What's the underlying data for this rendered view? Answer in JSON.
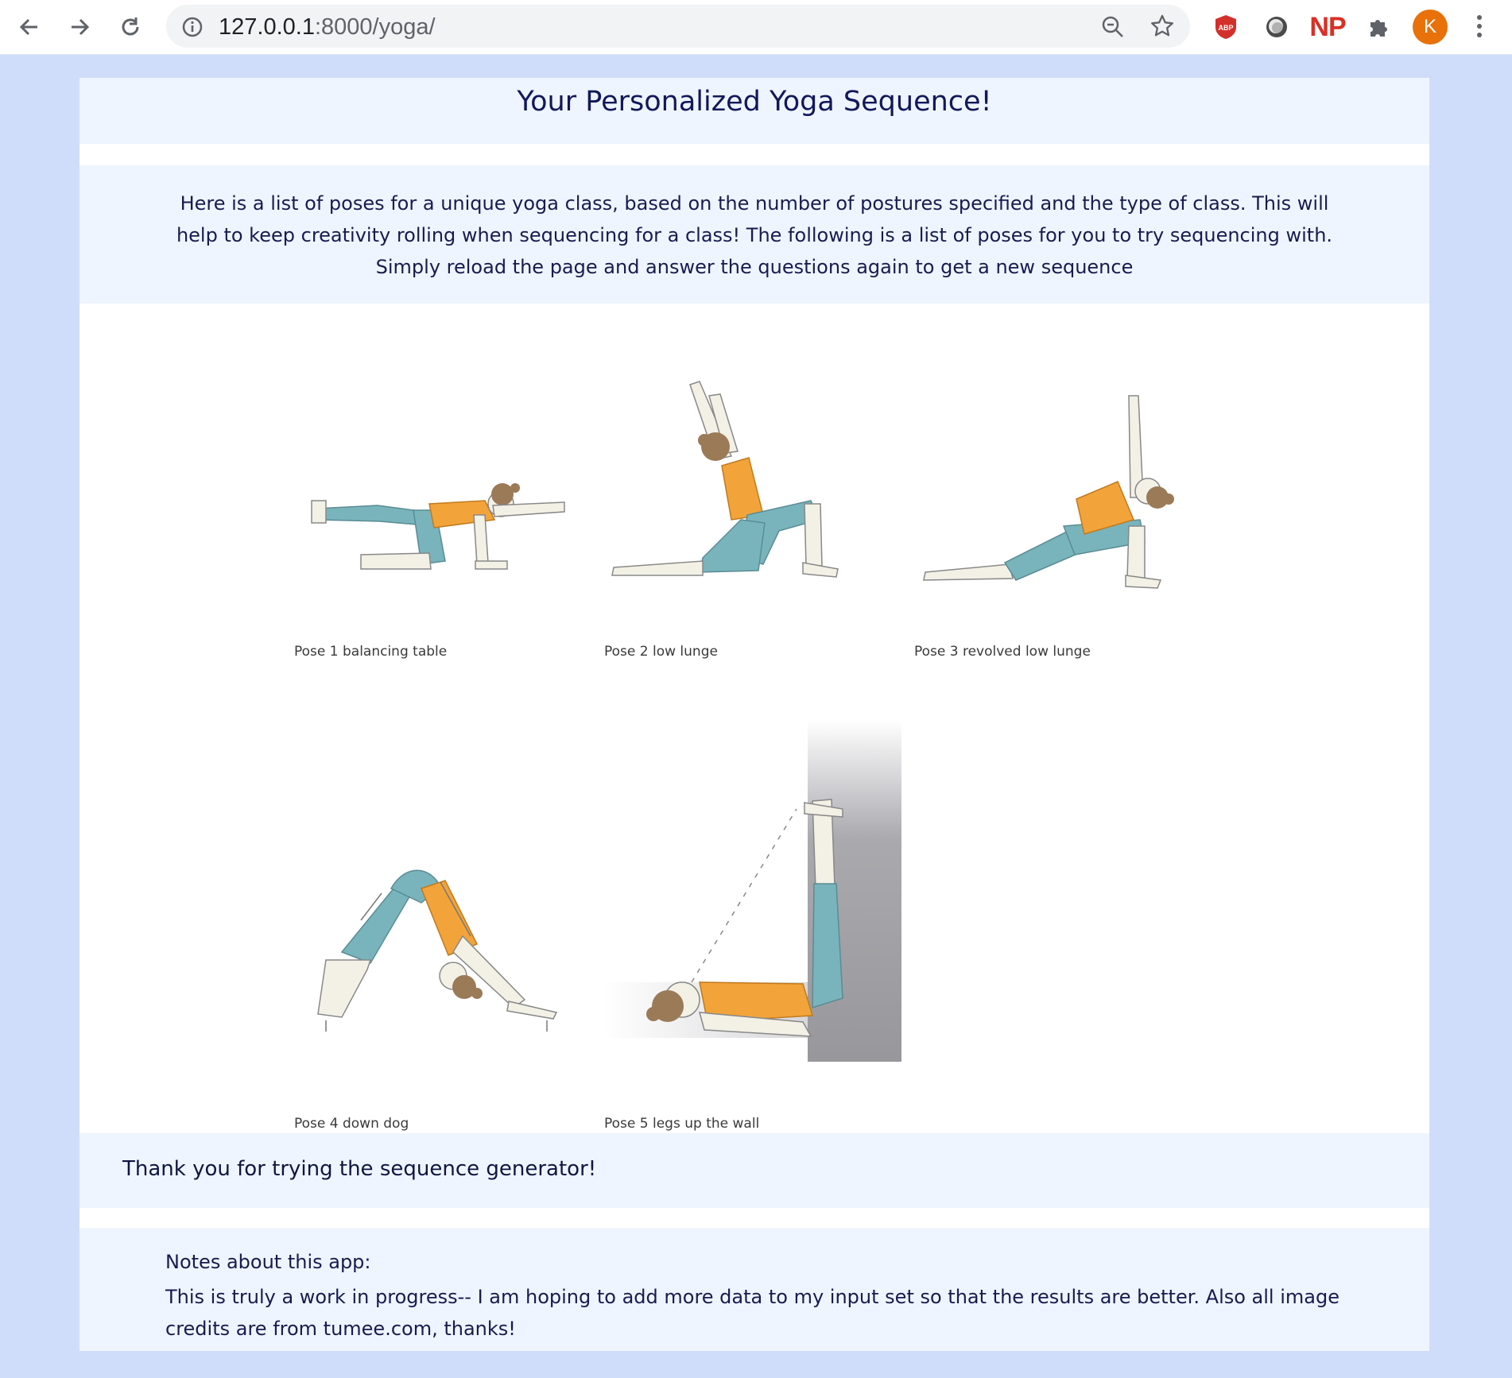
{
  "browser": {
    "url_host": "127.0.0.1",
    "url_rest": ":8000/yoga/",
    "extensions": [
      "adblock-icon",
      "record-icon",
      "np-extension-icon",
      "puzzle-extensions-icon"
    ],
    "np_label": "NP",
    "profile_initial": "K",
    "colors": {
      "profile": "#e8710a",
      "np": "#d93025"
    }
  },
  "page": {
    "title": "Your Personalized Yoga Sequence!",
    "intro": "Here is a list of poses for a unique yoga class, based on the number of postures specified and the type of class. This will help to keep creativity rolling when sequencing for a class! The following is a list of poses for you to try sequencing with. Simply reload the page and answer the questions again to get a new sequence",
    "poses": [
      {
        "caption": "Pose 1 balancing table"
      },
      {
        "caption": "Pose 2 low lunge"
      },
      {
        "caption": "Pose 3 revolved low lunge"
      },
      {
        "caption": "Pose 4 down dog"
      },
      {
        "caption": "Pose 5 legs up the wall"
      }
    ],
    "thanks": "Thank you for trying the sequence generator!",
    "notes_heading": "Notes about this app:",
    "notes_text": "This is truly a work in progress-- I am hoping to add more data to my input set so that the results are better. Also all image credits are from tumee.com, thanks!",
    "colors": {
      "band": "#eff5fe",
      "backdrop": "#cfddfa",
      "top": "#f2a43a",
      "pants": "#79b4bc",
      "skin": "#f3f1e6",
      "hair": "#9b7a58"
    }
  }
}
